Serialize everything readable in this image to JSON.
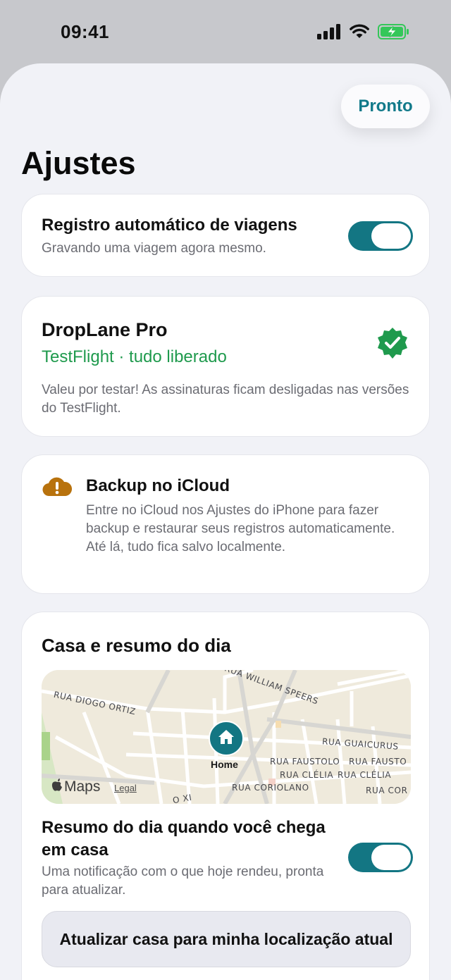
{
  "status_bar": {
    "time": "09:41",
    "icons": [
      "signal-icon",
      "wifi-icon",
      "battery-charging-icon"
    ],
    "battery_color": "#34c759"
  },
  "header": {
    "done_label": "Pronto",
    "title": "Ajustes"
  },
  "trip_logging": {
    "title": "Registro automático de viagens",
    "subtitle": "Gravando uma viagem agora mesmo.",
    "toggle_on": true
  },
  "pro": {
    "title": "DropLane Pro",
    "status": "TestFlight · tudo liberado",
    "description": "Valeu por testar! As assinaturas ficam desligadas nas versões do TestFlight.",
    "badge_icon": "verified-badge-icon",
    "badge_color": "#1f9a4d"
  },
  "icloud": {
    "icon": "cloud-warning-icon",
    "icon_color": "#b8720d",
    "title": "Backup no iCloud",
    "description": "Entre no iCloud nos Ajustes do iPhone para fazer backup e restaurar seus registros automaticamente. Até lá, tudo fica salvo localmente."
  },
  "home": {
    "section_title": "Casa e resumo do dia",
    "map": {
      "pin_label": "Home",
      "streets": [
        "RUA WILLIAM SPEERS",
        "RUA DIOGO ORTIZ",
        "RUA GUAICURUS",
        "RUA FAUSTOLO",
        "RUA FAUSTO",
        "RUA CLÉLIA",
        "RUA CLÉLIA",
        "RUA CORIOLANO",
        "RUA COR",
        "O XI"
      ],
      "attribution": "Maps",
      "legal": "Legal"
    },
    "daily_summary_title": "Resumo do dia quando você chega em casa",
    "daily_summary_sub": "Uma notificação com o que hoje rendeu, pronta para atualizar.",
    "toggle_on": true,
    "update_button": "Atualizar casa para minha localização atual"
  },
  "accent_color": "#137683"
}
